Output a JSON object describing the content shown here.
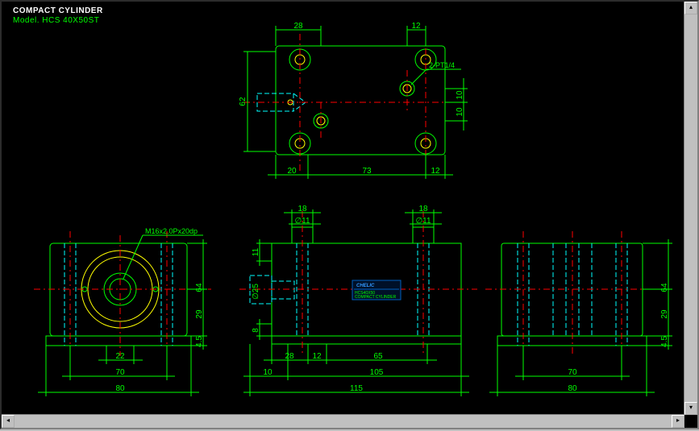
{
  "header": {
    "title": "COMPACT CYLINDER",
    "model": "Model. HCS 40X50ST"
  },
  "top_view": {
    "dims": {
      "d28": "28",
      "d12": "12",
      "d62": "62",
      "d20": "20",
      "d73": "73",
      "d12b": "12",
      "d10a": "10",
      "d10b": "10"
    },
    "callouts": {
      "pt14": "2-PT1/4"
    }
  },
  "front_left": {
    "callouts": {
      "thread": "M16x2.0Px20dp"
    },
    "dims": {
      "d22": "22",
      "d70": "70",
      "d80": "80",
      "d64": "64",
      "d29": "29",
      "d45": "4.5"
    }
  },
  "front_mid": {
    "dims": {
      "d18a": "18",
      "d18b": "18",
      "d11": "11",
      "dphi11a": "∅11",
      "dphi11b": "∅11",
      "dphi25": "∅25",
      "d8": "8",
      "d28": "28",
      "d12": "12",
      "d65": "65",
      "d10": "10",
      "d105": "105",
      "d115": "115"
    },
    "brand": "CHELIC",
    "label1": "HCS40X50",
    "label2": "COMPACT CYLINDER"
  },
  "front_right": {
    "dims": {
      "d70": "70",
      "d80": "80",
      "d64": "64",
      "d29": "29",
      "d45": "4.5"
    }
  }
}
